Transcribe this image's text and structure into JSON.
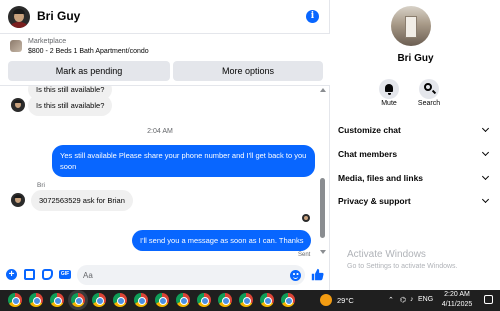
{
  "header": {
    "contact_name": "Bri Guy"
  },
  "listing": {
    "category": "Marketplace",
    "title": "$800 - 2 Beds 1 Bath Apartment/condo",
    "mark_pending_label": "Mark as pending",
    "more_options_label": "More options"
  },
  "messages": {
    "partial_top": "Is this still available?",
    "incoming_1": "Is this still available?",
    "timestamp": "2:04 AM",
    "outgoing_1": "Yes still available Please share your phone number and I'll get back to you soon",
    "sender_name": "Bri",
    "incoming_2": "3072563529 ask for Brian",
    "outgoing_2": "I'll send you a message as soon as I can. Thanks",
    "sent_status": "Sent"
  },
  "composer": {
    "placeholder": "Aa",
    "gif_label": "GIF"
  },
  "info_panel": {
    "name": "Bri Guy",
    "mute_label": "Mute",
    "search_label": "Search",
    "sections": [
      "Customize chat",
      "Chat members",
      "Media, files and links",
      "Privacy & support"
    ],
    "watermark_title": "Activate Windows",
    "watermark_subtitle": "Go to Settings to activate Windows."
  },
  "taskbar": {
    "temperature": "29°C",
    "language": "ENG",
    "time": "2:20 AM",
    "date": "4/11/2025",
    "app_count": 14
  },
  "colors": {
    "accent": "#0866ff",
    "bubble_in": "#f0f0f0",
    "taskbar": "#1f1f1f"
  },
  "icons": [
    "info-icon",
    "bell-icon",
    "search-icon",
    "plus-icon",
    "photo-icon",
    "sticker-icon",
    "gif-icon",
    "emoji-icon",
    "like-icon",
    "chevron-down-icon"
  ]
}
